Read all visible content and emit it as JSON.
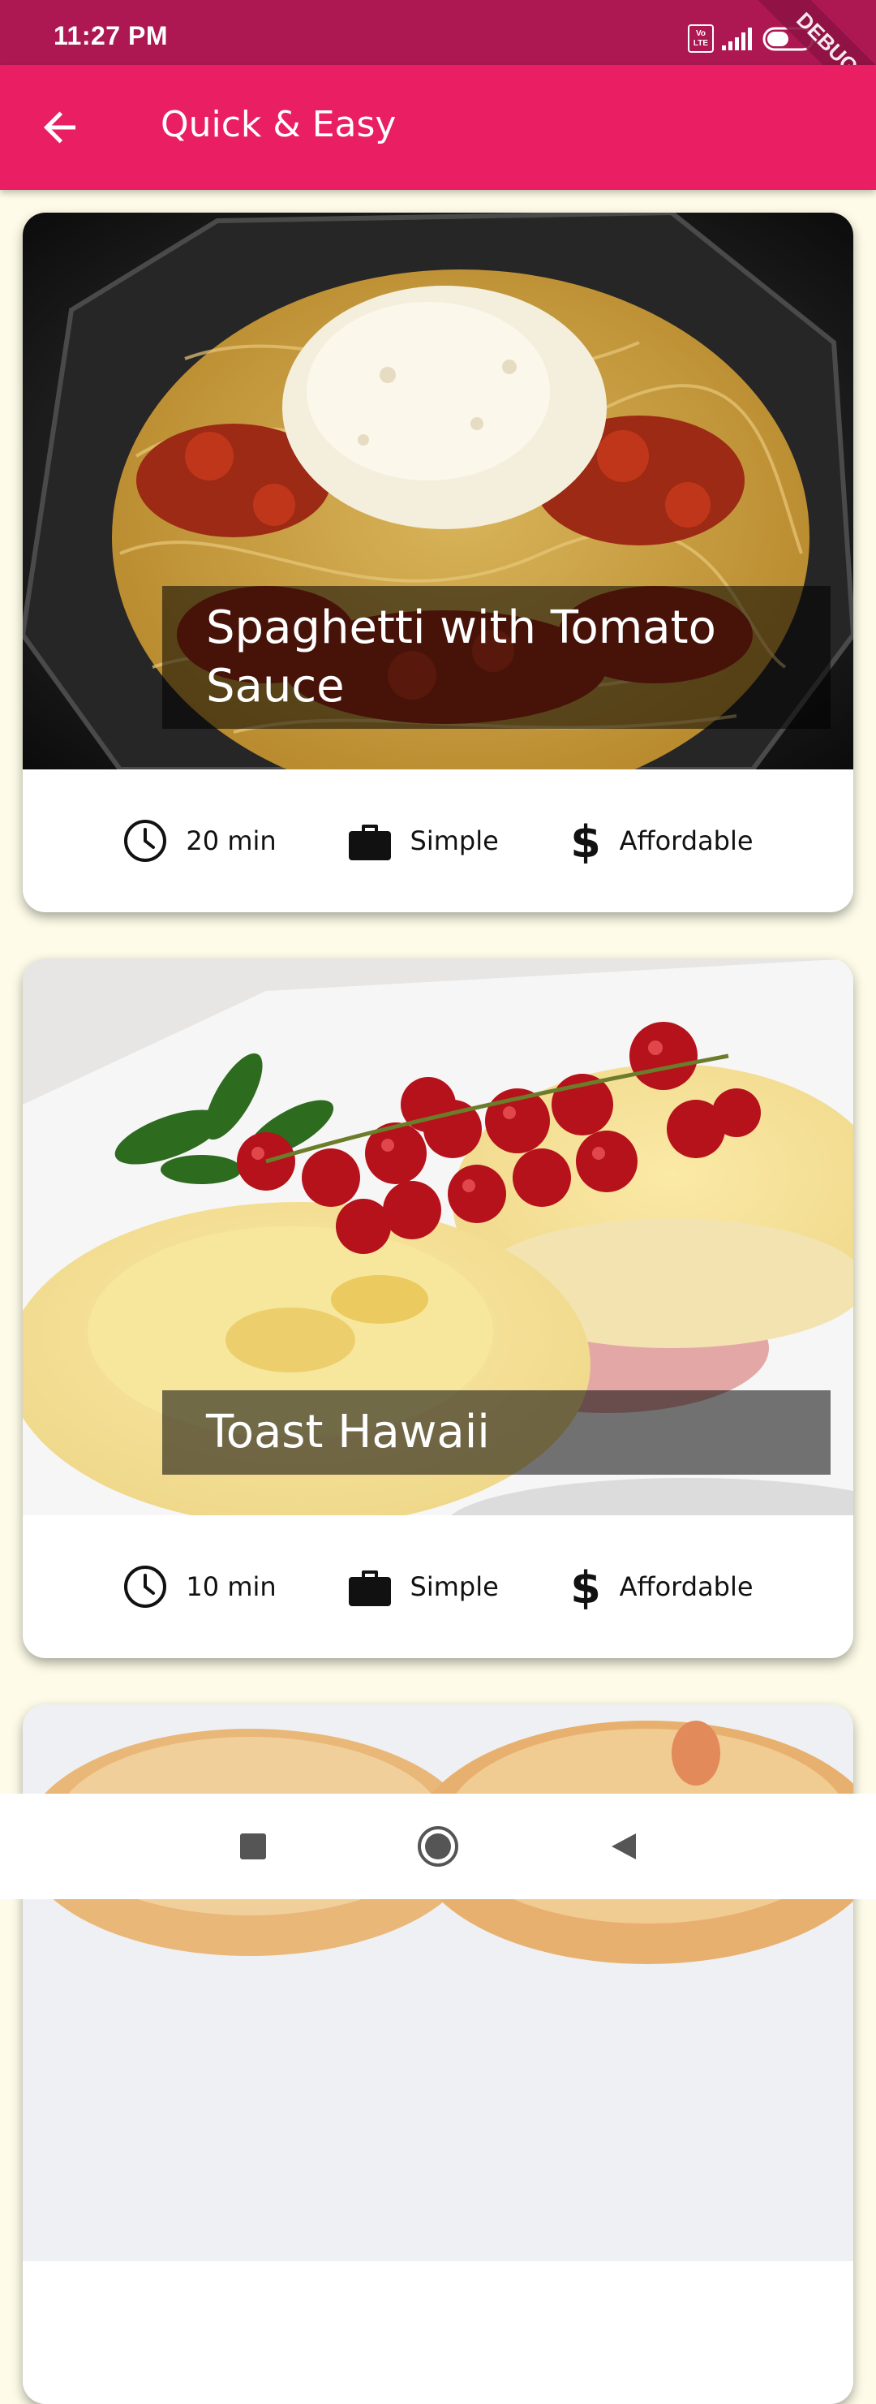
{
  "status_bar": {
    "time": "11:27 PM",
    "volte": "Vo LTE",
    "battery": "49 %",
    "debug_banner": "DEBUG"
  },
  "app_bar": {
    "title": "Quick & Easy",
    "back_icon": "arrow-back-icon"
  },
  "meals": [
    {
      "title": "Spaghetti with Tomato Sauce",
      "duration": "20 min",
      "complexity": "Simple",
      "affordability": "Affordable"
    },
    {
      "title": "Toast Hawaii",
      "duration": "10 min",
      "complexity": "Simple",
      "affordability": "Affordable"
    },
    {
      "title": "",
      "duration": "",
      "complexity": "",
      "affordability": ""
    }
  ],
  "icons": {
    "duration": "clock-icon",
    "complexity": "briefcase-icon",
    "affordability": "dollar-icon"
  },
  "colors": {
    "status_bar": "#AD1852",
    "app_bar": "#E91E63",
    "background": "#FEFCE8"
  },
  "nav": [
    "recents-button",
    "home-button",
    "back-button"
  ]
}
